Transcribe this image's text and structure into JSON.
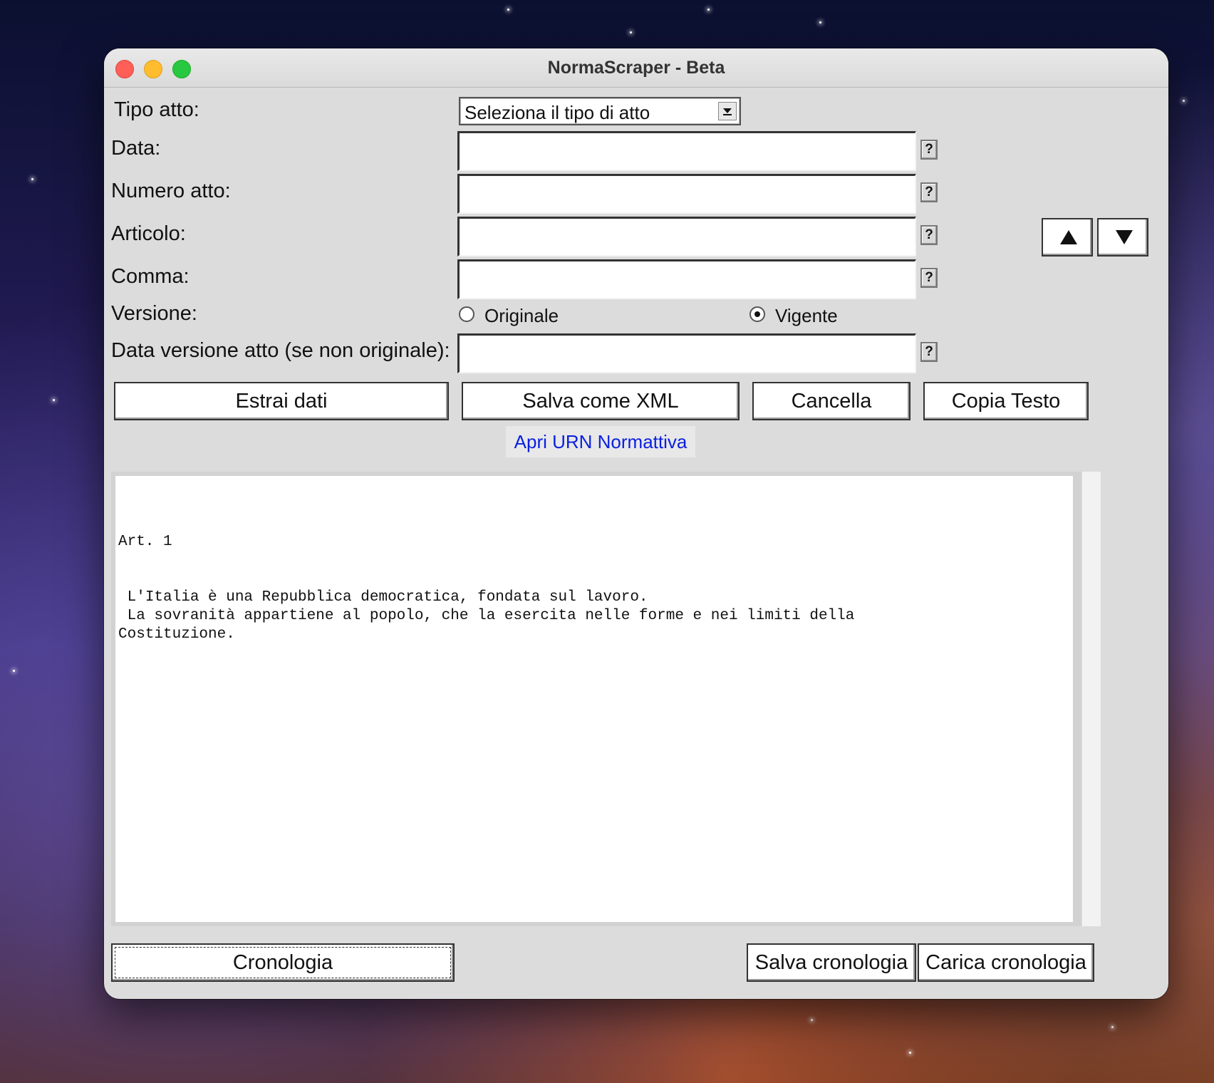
{
  "window": {
    "title": "NormaScraper - Beta"
  },
  "form": {
    "tipo_atto_label": "Tipo atto:",
    "tipo_atto_value": "Seleziona il tipo di atto",
    "data_label": "Data:",
    "numero_label": "Numero atto:",
    "articolo_label": "Articolo:",
    "comma_label": "Comma:",
    "versione_label": "Versione:",
    "data_versione_label": "Data versione atto (se non originale):",
    "help_label": "?",
    "versione_options": [
      {
        "label": "Originale",
        "selected": false
      },
      {
        "label": "Vigente",
        "selected": true
      }
    ],
    "fields": {
      "data": "",
      "numero": "",
      "articolo": "",
      "comma": "",
      "data_versione": ""
    }
  },
  "nav": {
    "up_icon": "triangle-up-icon",
    "down_icon": "triangle-down-icon"
  },
  "actions": {
    "estrai": "Estrai dati",
    "salva_xml": "Salva come XML",
    "cancella": "Cancella",
    "copia": "Copia Testo",
    "urn_link": "Apri URN Normattiva"
  },
  "output": {
    "text": "Art. 1\n\n\n L'Italia è una Repubblica democratica, fondata sul lavoro.\n La sovranità appartiene al popolo, che la esercita nelle forme e nei limiti della\nCostituzione."
  },
  "history": {
    "cronologia": "Cronologia",
    "salva": "Salva cronologia",
    "carica": "Carica cronologia"
  },
  "colors": {
    "window_bg": "#dcdcdc",
    "link": "#0a1fe0",
    "close": "#fe5f57",
    "minimize": "#febc2e",
    "maximize": "#28c840"
  }
}
